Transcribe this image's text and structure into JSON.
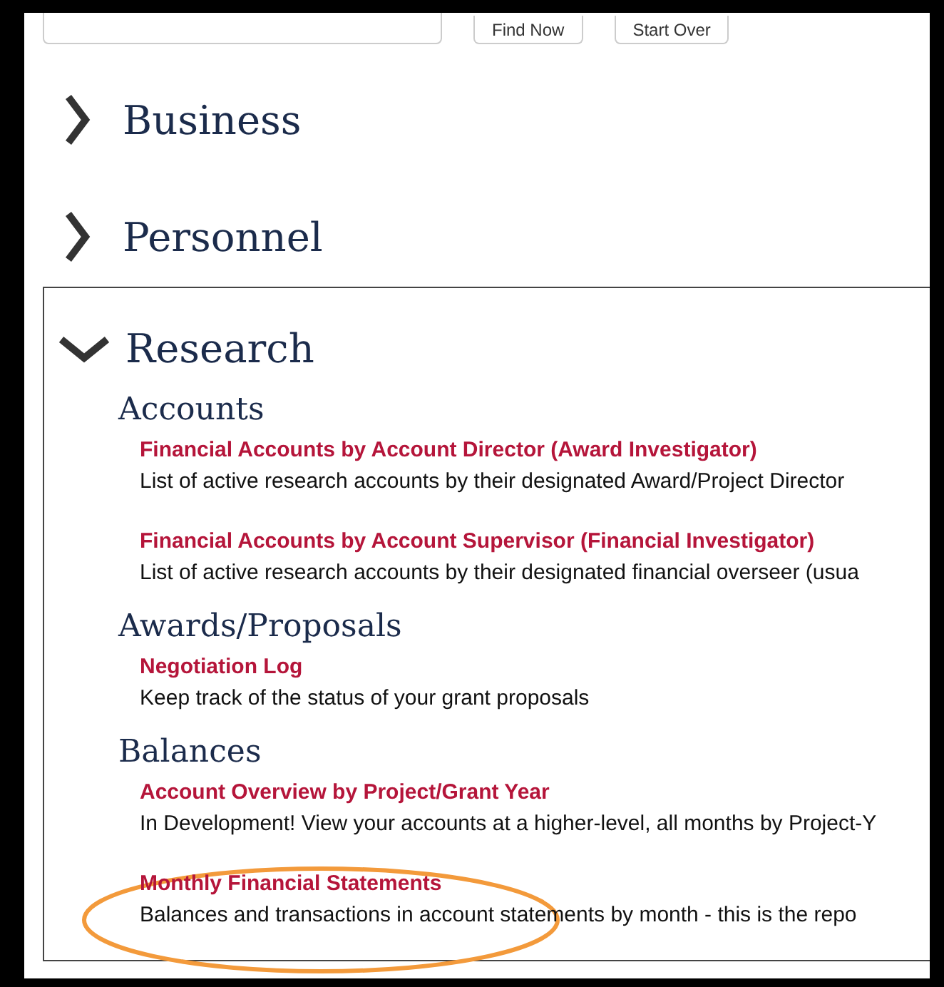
{
  "search": {
    "buttons": [
      "Find Now",
      "Start Over"
    ]
  },
  "sections": [
    {
      "title": "Business",
      "expanded": false
    },
    {
      "title": "Personnel",
      "expanded": false
    },
    {
      "title": "Research",
      "expanded": true,
      "groups": [
        {
          "title": "Accounts",
          "reports": [
            {
              "title": "Financial Accounts by Account Director (Award Investigator)",
              "description": "List of active research accounts by their designated Award/Project Director"
            },
            {
              "title": "Financial Accounts by Account Supervisor (Financial Investigator)",
              "description": "List of active research accounts by their designated financial overseer (usua"
            }
          ]
        },
        {
          "title": "Awards/Proposals",
          "reports": [
            {
              "title": "Negotiation Log",
              "description": "Keep track of the status of your grant proposals"
            }
          ]
        },
        {
          "title": "Balances",
          "reports": [
            {
              "title": "Account Overview by Project/Grant Year",
              "description": "In Development! View your accounts at a higher-level, all months by Project-Y"
            },
            {
              "title": "Monthly Financial Statements",
              "description": "Balances and transactions in account statements by month - this is the repo",
              "highlighted": true
            }
          ]
        }
      ]
    }
  ]
}
